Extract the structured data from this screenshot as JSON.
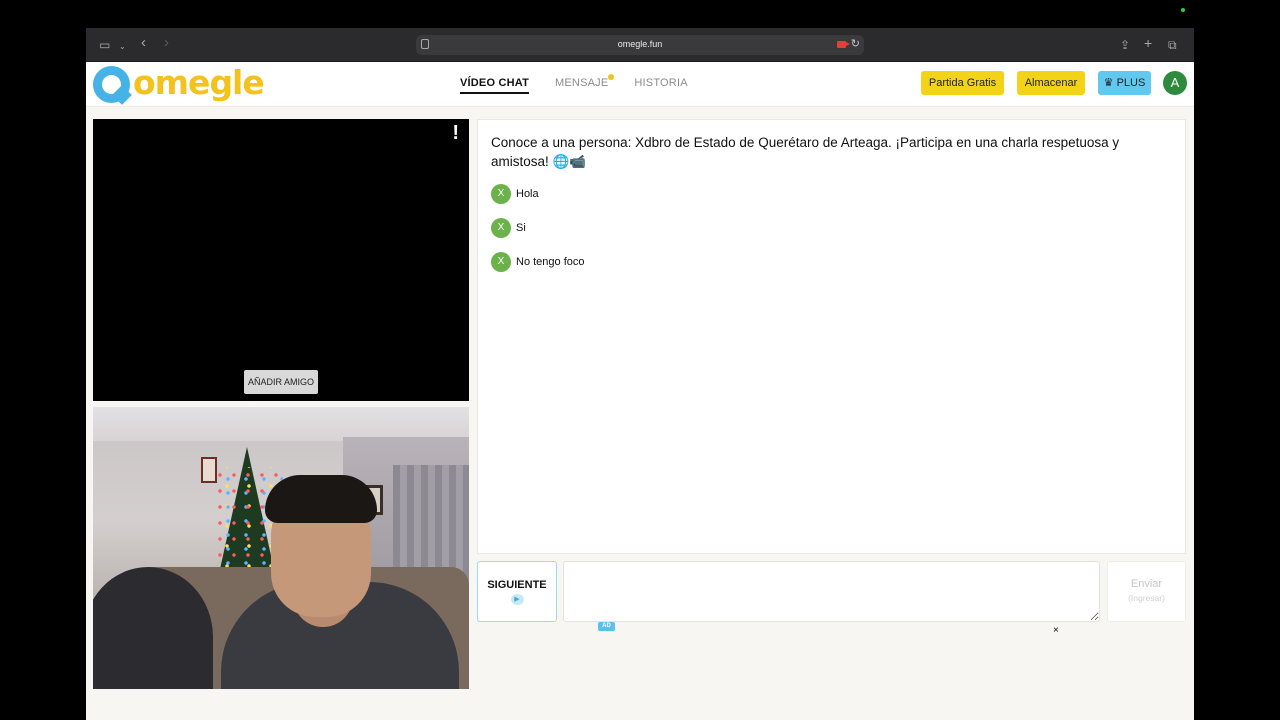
{
  "browser": {
    "url": "omegle.fun",
    "icons": {
      "sidebar": "sidebar-icon",
      "back": "chevron-left-icon",
      "forward": "chevron-right-icon",
      "camera": "camera-icon",
      "reload": "reload-icon",
      "share": "share-icon",
      "new_tab": "plus-icon",
      "tabs": "tabs-icon"
    }
  },
  "site": {
    "logo_text": "omegle",
    "nav": [
      {
        "label": "VÍDEO CHAT",
        "active": true
      },
      {
        "label": "MENSAJE",
        "active": false,
        "notification": true
      },
      {
        "label": "HISTORIA",
        "active": false
      }
    ],
    "buttons": {
      "free_match": "Partida Gratis",
      "store": "Almacenar",
      "plus": "PLUS"
    },
    "avatar_initial": "A",
    "colors": {
      "logo_blue": "#45b3e6",
      "logo_yellow": "#f3c21c",
      "button_yellow": "#f3d318",
      "plus_blue": "#61c8ef",
      "avatar_green": "#2e8b3e",
      "message_green": "#6cb24a"
    }
  },
  "video": {
    "report_label": "!",
    "add_friend_label": "AÑADIR AMIGO"
  },
  "chat": {
    "intro": "Conoce a una persona: Xdbro de Estado de Querétaro de Arteaga. ¡Participa en una charla respetuosa y amistosa! 🌐📹",
    "messages": [
      {
        "sender_initial": "X",
        "text": "Hola"
      },
      {
        "sender_initial": "X",
        "text": "Si"
      },
      {
        "sender_initial": "X",
        "text": "No tengo foco"
      }
    ]
  },
  "controls": {
    "next_label": "SIGUIENTE",
    "next_icon": "play-icon",
    "message_value": "",
    "send_label": "Enviar",
    "send_sub": "(Ingresar)"
  },
  "ad": {
    "badge": "AD",
    "close": "×"
  }
}
